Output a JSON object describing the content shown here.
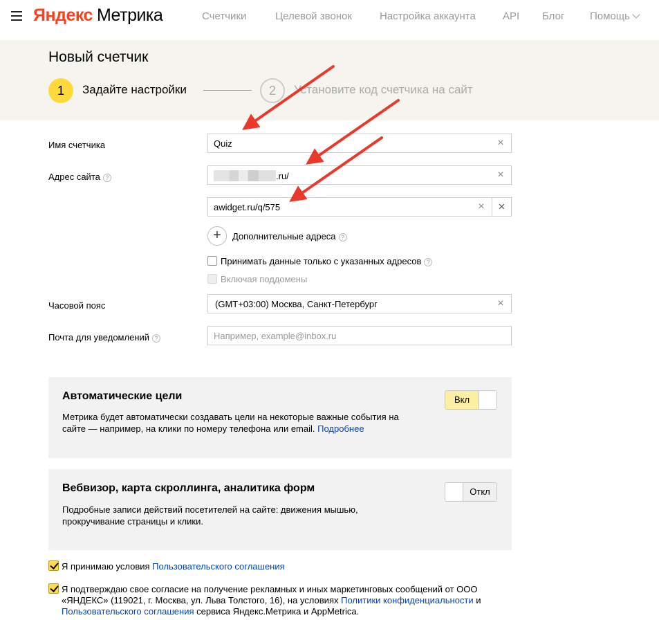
{
  "header": {
    "logo_brand": "Яндекс",
    "logo_product": "Метрика",
    "nav": [
      "Счетчики",
      "Целевой звонок",
      "Настройка аккаунта",
      "API",
      "Блог",
      "Помощь"
    ]
  },
  "page": {
    "title": "Новый счетчик",
    "steps": [
      {
        "number": "1",
        "label": "Задайте настройки"
      },
      {
        "number": "2",
        "label": "Установите код счетчика на сайт"
      }
    ]
  },
  "form": {
    "counter_name": {
      "label": "Имя счетчика",
      "value": "Quiz"
    },
    "site_address": {
      "label": "Адрес сайта",
      "value_suffix": ".ru/",
      "extra_value": "awidget.ru/q/575"
    },
    "additional_addresses": "Дополнительные адреса",
    "only_listed": "Принимать данные только с указанных адресов",
    "include_subdomains": "Включая поддомены",
    "timezone": {
      "label": "Часовой пояс",
      "value": "(GMT+03:00) Москва, Санкт-Петербург"
    },
    "email": {
      "label": "Почта для уведомлений",
      "placeholder": "Например, example@inbox.ru"
    },
    "help_glyph": "?",
    "clear_glyph": "×",
    "add_glyph": "+"
  },
  "auto_goals": {
    "title": "Автоматические цели",
    "desc": "Метрика будет автоматически создавать цели на некоторые важные события на сайте — например, на клики по номеру телефона или email.",
    "link": "Подробнее",
    "toggle_label": "Вкл",
    "state": "on"
  },
  "webvisor": {
    "title": "Вебвизор, карта скроллинга, аналитика форм",
    "desc": "Подробные записи действий посетителей на сайте: движения мышью, прокручивание страницы и клики.",
    "toggle_label": "Откл",
    "state": "off"
  },
  "agreements": {
    "accept_prefix": "Я принимаю условия",
    "accept_link": "Пользовательского соглашения",
    "consent_prefix": "Я подтверждаю свое согласие на получение рекламных и иных маркетинговых сообщений от ООО «ЯНДЕКС» (119021, г. Москва, ул. Льва Толстого, 16), на условиях",
    "privacy_link": "Политики конфиденциальности",
    "and": "и",
    "terms_link": "Пользовательского соглашения",
    "consent_suffix": "сервиса Яндекс.Метрика и AppMetrica."
  },
  "colors": {
    "brand_red": "#fc3f1d",
    "accent_yellow": "#ffd83c",
    "link_blue": "#04b",
    "arrow_red": "#e8392b"
  }
}
